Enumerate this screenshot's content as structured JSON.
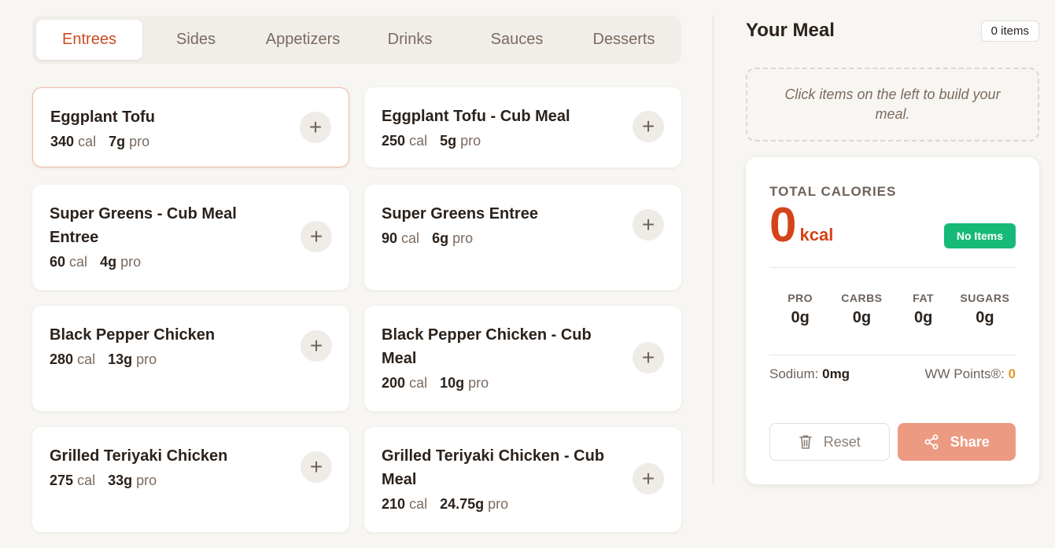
{
  "tabs": [
    {
      "label": "Entrees",
      "active": true
    },
    {
      "label": "Sides"
    },
    {
      "label": "Appetizers"
    },
    {
      "label": "Drinks"
    },
    {
      "label": "Sauces"
    },
    {
      "label": "Desserts"
    }
  ],
  "items": [
    {
      "name": "Eggplant Tofu",
      "cal": "340",
      "pro": "7g"
    },
    {
      "name": "Eggplant Tofu - Cub Meal",
      "cal": "250",
      "pro": "5g"
    },
    {
      "name": "Super Greens - Cub Meal Entree",
      "cal": "60",
      "pro": "4g"
    },
    {
      "name": "Super Greens Entree",
      "cal": "90",
      "pro": "6g"
    },
    {
      "name": "Black Pepper Chicken",
      "cal": "280",
      "pro": "13g"
    },
    {
      "name": "Black Pepper Chicken - Cub Meal",
      "cal": "200",
      "pro": "10g"
    },
    {
      "name": "Grilled Teriyaki Chicken",
      "cal": "275",
      "pro": "33g"
    },
    {
      "name": "Grilled Teriyaki Chicken - Cub Meal",
      "cal": "210",
      "pro": "24.75g"
    }
  ],
  "units": {
    "cal": "cal",
    "pro": "pro"
  },
  "meal": {
    "title": "Your Meal",
    "count": "0 items",
    "empty_text": "Click items on the left to build your meal.",
    "total_label": "TOTAL CALORIES",
    "total_value": "0",
    "total_unit": "kcal",
    "status": "No Items",
    "macros": [
      {
        "label": "PRO",
        "value": "0g"
      },
      {
        "label": "CARBS",
        "value": "0g"
      },
      {
        "label": "FAT",
        "value": "0g"
      },
      {
        "label": "SUGARS",
        "value": "0g"
      }
    ],
    "sodium_label": "Sodium:",
    "sodium_value": "0mg",
    "ww_label": "WW Points®:",
    "ww_value": "0",
    "reset_label": "Reset",
    "share_label": "Share"
  },
  "colors": {
    "accent": "#d4431a",
    "status_green": "#17b978",
    "share": "#ec9a82"
  },
  "icons": {
    "add": "plus-icon",
    "reset": "trash-icon",
    "share": "share-icon"
  }
}
